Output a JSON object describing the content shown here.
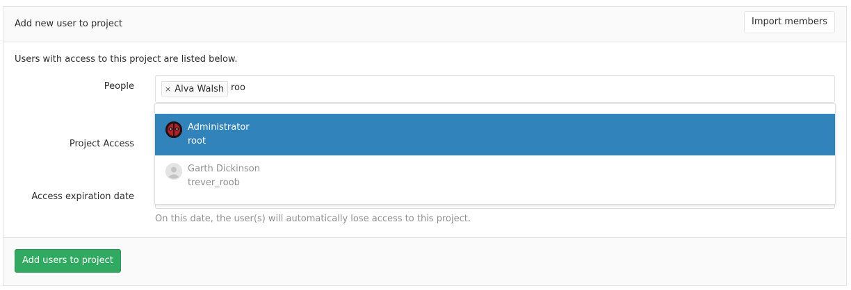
{
  "panel": {
    "title": "Add new user to project",
    "import_button": "Import members"
  },
  "intro": "Users with access to this project are listed below.",
  "form": {
    "people_label": "People",
    "token_remove_icon": "×",
    "selected_token": "Alva Walsh",
    "typed_text": "roo",
    "project_access_label": "Project Access",
    "expiration_label": "Access expiration date",
    "expiration_help": "On this date, the user(s) will automatically lose access to this project."
  },
  "dropdown": {
    "options": [
      {
        "name": "Administrator",
        "username": "root",
        "avatar_icon": "deadpool-avatar-icon",
        "highlighted": true
      },
      {
        "name": "Garth Dickinson",
        "username": "trever_roob",
        "avatar_icon": "default-user-avatar-icon",
        "highlighted": false
      }
    ]
  },
  "footer": {
    "submit_button": "Add users to project"
  },
  "colors": {
    "highlight": "#3084bb",
    "submit": "#2faa60",
    "help_text": "#909090"
  }
}
